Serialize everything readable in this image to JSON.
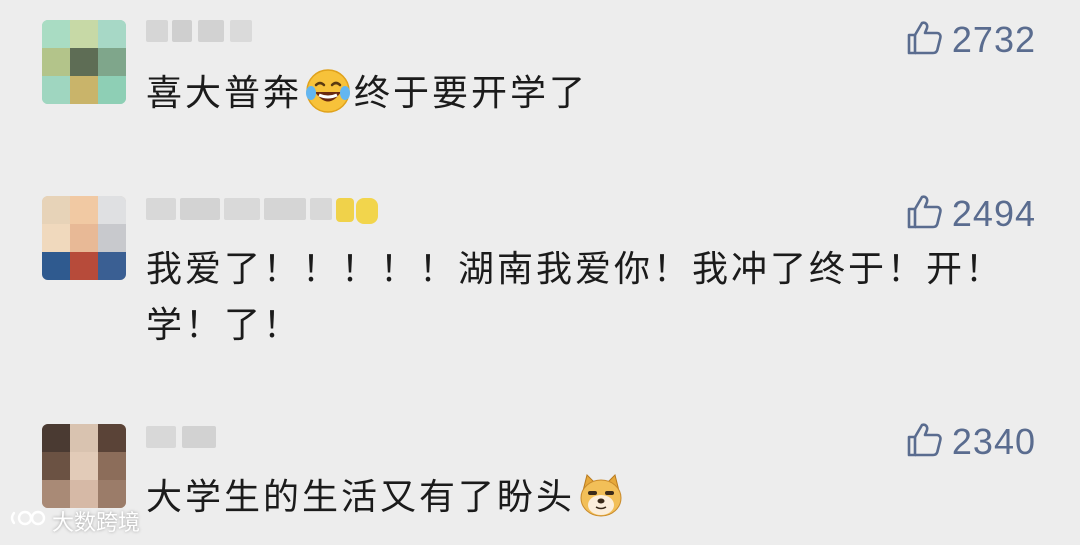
{
  "comments": [
    {
      "text_before_emoji": "喜大普奔",
      "emoji": "laughing-tears-emoji",
      "text_after_emoji": "终于要开学了",
      "likes": "2732"
    },
    {
      "text_line1": "我爱了！！！！！湖南我爱你！我冲了终于！开！",
      "text_line2": "学！了！",
      "likes": "2494"
    },
    {
      "text_before_emoji": "大学生的生活又有了盼头",
      "emoji": "doge-emoji",
      "likes": "2340"
    }
  ],
  "icons": {
    "like": "thumbs-up-icon",
    "watermark_logo": "weibo-style-logo"
  },
  "watermark": {
    "text": "大数跨境"
  },
  "colors": {
    "background": "#ededed",
    "like_color": "#5a6c8f",
    "text_color": "#1b1b1b"
  }
}
